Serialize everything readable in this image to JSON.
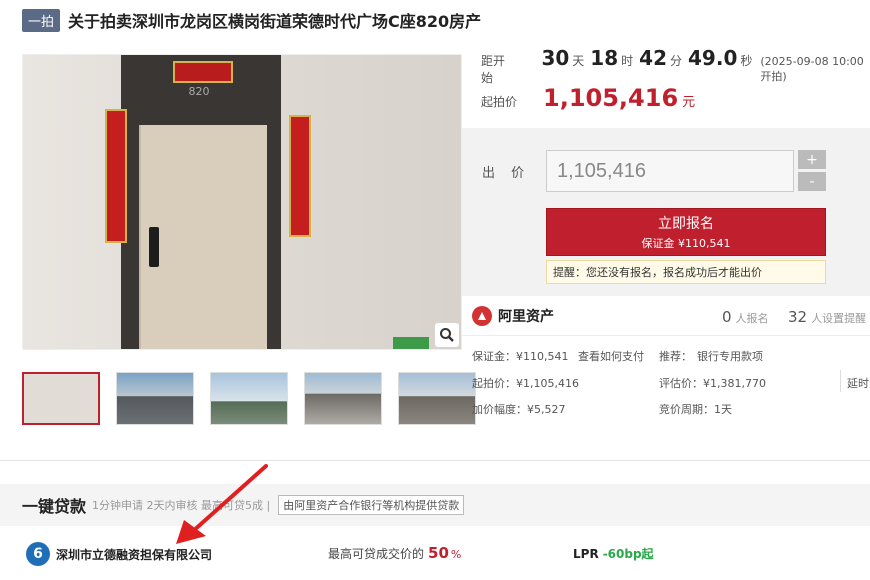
{
  "header": {
    "badge": "一拍",
    "title": "关于拍卖深圳市龙岗区横岗街道荣德时代广场C座820房产"
  },
  "gallery": {
    "door_number": "820",
    "thumbnails": 5,
    "zoom_icon": "magnifier-icon"
  },
  "countdown": {
    "label": "距开始",
    "days": "30",
    "days_unit": "天",
    "hours": "18",
    "hours_unit": "时",
    "minutes": "42",
    "minutes_unit": "分",
    "seconds": "49.0",
    "seconds_unit": "秒",
    "start_time": "(2025-09-08 10:00开拍)"
  },
  "start_price": {
    "label": "起拍价",
    "value": "1,105,416",
    "unit": "元"
  },
  "bid": {
    "label": "出 价",
    "input_value": "1,105,416",
    "plus": "+",
    "minus": "-",
    "signup_label": "立即报名",
    "deposit_label": "保证金 ¥110,541",
    "tip": "提醒：您还没有报名，报名成功后才能出价"
  },
  "ali": {
    "name": "阿里资产",
    "registered_count": "0",
    "registered_label": "人报名",
    "reminder_count": "32",
    "reminder_label": "人设置提醒"
  },
  "info": {
    "deposit": "保证金：¥110,541",
    "how_to_pay": "查看如何支付",
    "recommend_label": "推荐：",
    "recommend_link": "银行专用款项",
    "start_price": "起拍价：¥1,105,416",
    "appraisal": "评估价：¥1,381,770",
    "delay": "延时",
    "increment": "加价幅度：¥5,527",
    "cycle": "竞价周期：1天"
  },
  "loan": {
    "title": "一键贷款",
    "subtitle": "1分钟申请 2天内审核 最高可贷5成 |",
    "tag": "由阿里资产合作银行等机构提供贷款",
    "bank_name": "深圳市立德融资担保有限公司",
    "max_label": "最高可贷成交价的",
    "max_value": "50",
    "max_unit": "%",
    "lpr_label": "LPR",
    "lpr_value": "-60bp起"
  },
  "colors": {
    "accent": "#c0202e",
    "link": "#2a63b8",
    "green": "#2aa84a"
  }
}
